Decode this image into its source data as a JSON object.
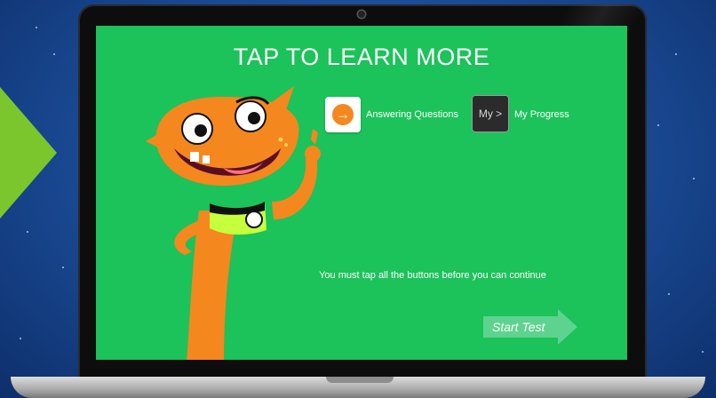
{
  "screen": {
    "title": "TAP TO LEARN MORE",
    "buttons": [
      {
        "icon": "arrow-right-icon",
        "label": "Answering Questions"
      },
      {
        "icon_text": "My >",
        "label": "My Progress"
      }
    ],
    "instruction": "You must tap all the buttons before you can continue",
    "start_label": "Start Test"
  },
  "colors": {
    "screen_bg": "#1cc25a",
    "accent_orange": "#f5871f",
    "side_arrow": "#7bc62d"
  }
}
